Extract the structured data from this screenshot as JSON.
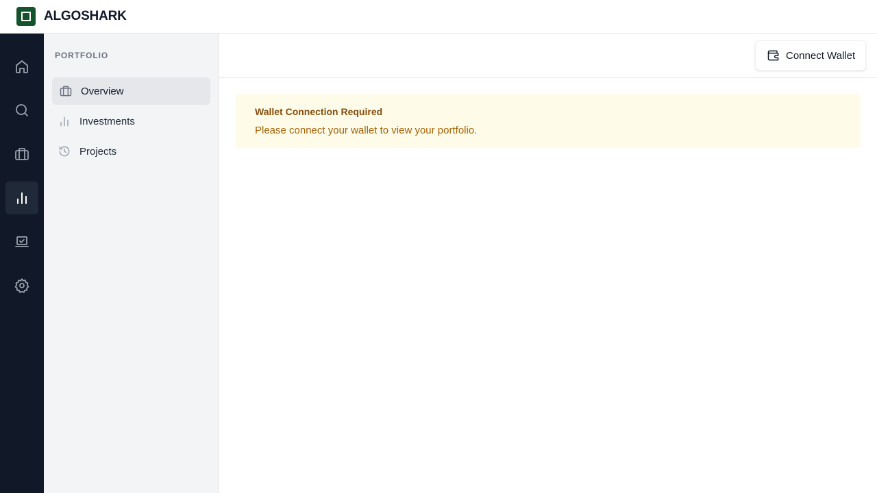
{
  "app": {
    "brand": "ALGOSHARK"
  },
  "rail": {
    "items": [
      {
        "icon": "home-icon",
        "active": false
      },
      {
        "icon": "search-icon",
        "active": false
      },
      {
        "icon": "briefcase-icon",
        "active": false
      },
      {
        "icon": "bar-chart-icon",
        "active": true
      },
      {
        "icon": "laptop-check-icon",
        "active": false
      },
      {
        "icon": "gear-icon",
        "active": false
      }
    ]
  },
  "subnav": {
    "title": "PORTFOLIO",
    "items": [
      {
        "label": "Overview",
        "icon": "briefcase-icon",
        "active": true
      },
      {
        "label": "Investments",
        "icon": "bar-chart-icon",
        "active": false
      },
      {
        "label": "Projects",
        "icon": "history-icon",
        "active": false
      }
    ]
  },
  "header": {
    "connect_label": "Connect Wallet",
    "connect_icon": "wallet-icon"
  },
  "alert": {
    "title": "Wallet Connection Required",
    "message": "Please connect your wallet to view your portfolio."
  },
  "colors": {
    "brand": "#14532d",
    "rail_bg": "#111827",
    "alert_bg": "#fefce8",
    "alert_title": "#854d0e",
    "alert_text": "#a16207"
  }
}
